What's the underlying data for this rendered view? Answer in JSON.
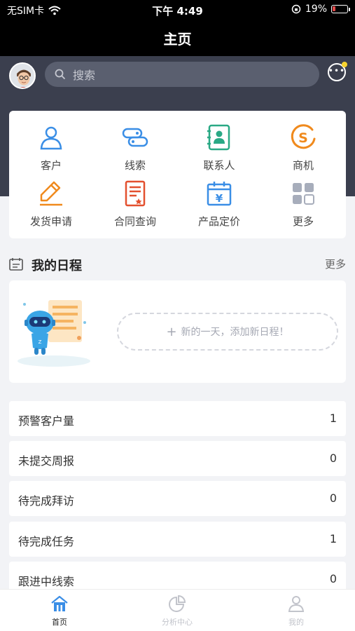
{
  "status_bar": {
    "carrier": "无SIM卡",
    "time": "下午 4:49",
    "battery": "19%"
  },
  "page_title": "主页",
  "search": {
    "placeholder": "搜索"
  },
  "functions": [
    {
      "label": "客户",
      "icon": "customer-icon"
    },
    {
      "label": "线索",
      "icon": "lead-icon"
    },
    {
      "label": "联系人",
      "icon": "contact-icon"
    },
    {
      "label": "商机",
      "icon": "opportunity-icon"
    },
    {
      "label": "发货申请",
      "icon": "shipping-request-icon"
    },
    {
      "label": "合同查询",
      "icon": "contract-icon"
    },
    {
      "label": "产品定价",
      "icon": "pricing-icon"
    },
    {
      "label": "更多",
      "icon": "more-grid-icon"
    }
  ],
  "schedule": {
    "title": "我的日程",
    "more": "更多",
    "add_text": "新的一天，添加新日程！"
  },
  "stats": [
    {
      "label": "预警客户量",
      "value": "1"
    },
    {
      "label": "未提交周报",
      "value": "0"
    },
    {
      "label": "待完成拜访",
      "value": "0"
    },
    {
      "label": "待完成任务",
      "value": "1"
    },
    {
      "label": "跟进中线索",
      "value": "0"
    }
  ],
  "tabs": [
    {
      "label": "首页",
      "active": true
    },
    {
      "label": "分析中心",
      "active": false
    },
    {
      "label": "我的",
      "active": false
    }
  ],
  "colors": {
    "header_bg": "#3b3f4e",
    "blue": "#3a8ee6",
    "orange": "#f08a1d",
    "green": "#2aa985",
    "red": "#e3502f"
  }
}
